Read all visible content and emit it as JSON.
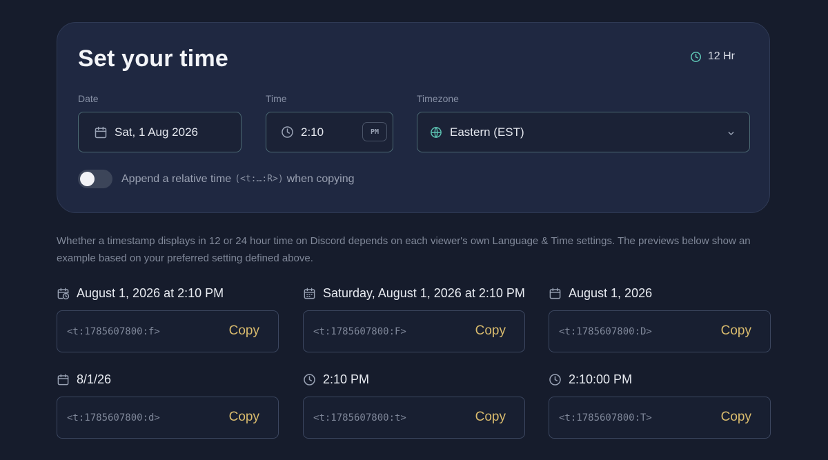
{
  "card": {
    "title": "Set your time",
    "hour_mode": "12 Hr",
    "date": {
      "label": "Date",
      "value": "Sat, 1 Aug 2026"
    },
    "time": {
      "label": "Time",
      "value": "2:10",
      "meridiem": "PM"
    },
    "timezone": {
      "label": "Timezone",
      "value": "Eastern (EST)"
    },
    "relative": {
      "enabled": false,
      "prefix": "Append a relative time",
      "code": "(<t:…:R>)",
      "suffix": "when copying"
    }
  },
  "info_text": "Whether a timestamp displays in 12 or 24 hour time on Discord depends on each viewer's own Language & Time settings. The previews below show an example based on your preferred setting defined above.",
  "formats": [
    {
      "label": "August 1, 2026 at 2:10 PM",
      "icon": "calendar-clock-icon",
      "code": "<t:1785607800:f>",
      "copy_label": "Copy"
    },
    {
      "label": "Saturday, August 1, 2026 at 2:10 PM",
      "icon": "calendar-icon",
      "code": "<t:1785607800:F>",
      "copy_label": "Copy"
    },
    {
      "label": "August 1, 2026",
      "icon": "calendar-icon",
      "code": "<t:1785607800:D>",
      "copy_label": "Copy"
    },
    {
      "label": "8/1/26",
      "icon": "calendar-icon",
      "code": "<t:1785607800:d>",
      "copy_label": "Copy"
    },
    {
      "label": "2:10 PM",
      "icon": "clock-icon",
      "code": "<t:1785607800:t>",
      "copy_label": "Copy"
    },
    {
      "label": "2:10:00 PM",
      "icon": "clock-icon",
      "code": "<t:1785607800:T>",
      "copy_label": "Copy"
    }
  ],
  "colors": {
    "background": "#161c2c",
    "card": "#1f2841",
    "accent_teal": "#5ec6b5",
    "copy_gold": "#d9bb6d"
  }
}
